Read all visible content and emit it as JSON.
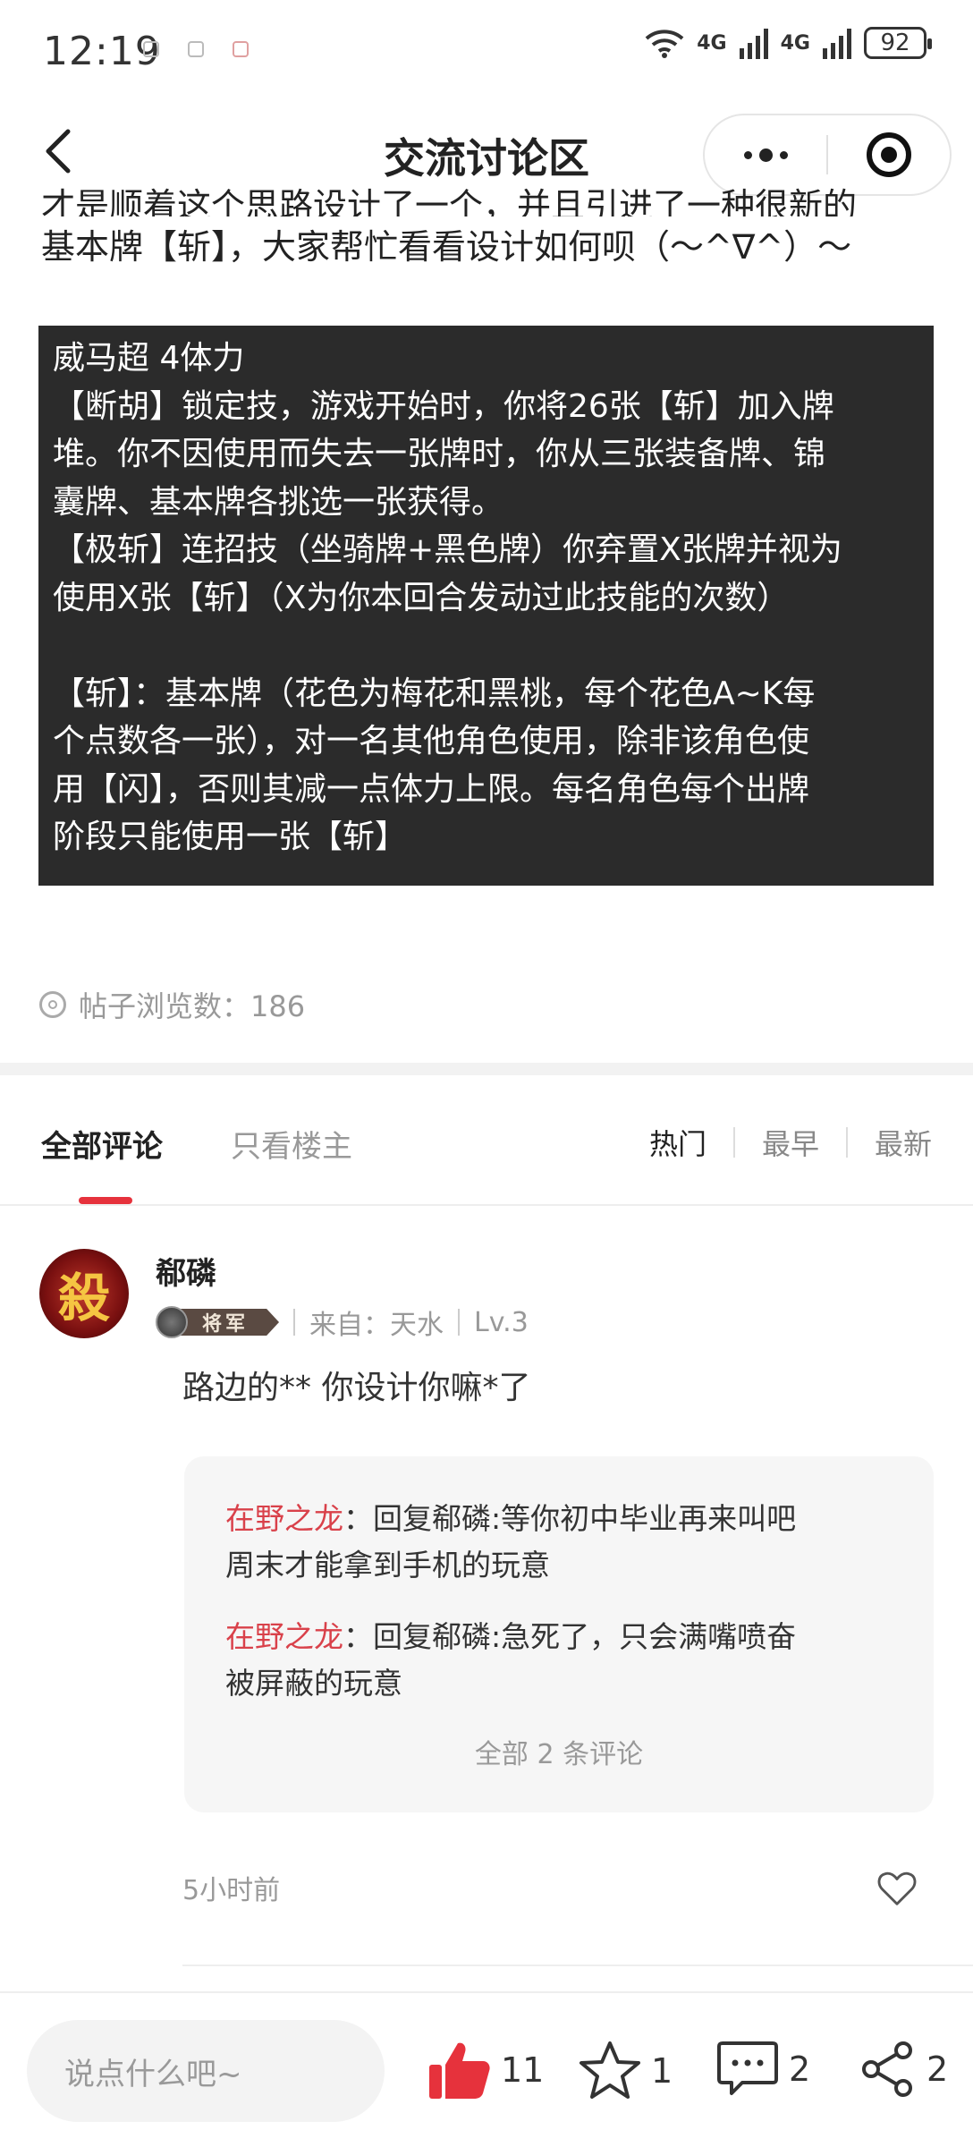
{
  "status_bar": {
    "time": "12:19",
    "network_1": "4G",
    "network_2": "4G",
    "battery": "92"
  },
  "header": {
    "title": "交流讨论区",
    "back_icon": "chevron-left-icon",
    "more_icon": "more-dots-icon",
    "close_icon": "target-circle-icon"
  },
  "post": {
    "intro_line_1": "才是顺着这个思路设计了一个，并且引进了一种很新的",
    "intro_line_2": "基本牌【斩】，大家帮忙看看设计如何呗（～^∇^）～",
    "box_lines": [
      "威马超  4体力",
      "【断胡】锁定技，游戏开始时，你将26张【斩】加入牌",
      "堆。你不因使用而失去一张牌时，你从三张装备牌、锦",
      "囊牌、基本牌各挑选一张获得。",
      "【极斩】连招技（坐骑牌+黑色牌）你弃置X张牌并视为",
      "使用X张【斩】（X为你本回合发动过此技能的次数）",
      "【斩】：基本牌（花色为梅花和黑桃，每个花色A~K每",
      "个点数各一张），对一名其他角色使用，除非该角色使",
      "用【闪】，否则其减一点体力上限。每名角色每个出牌",
      "阶段只能使用一张【斩】"
    ],
    "views_label": "帖子浏览数：",
    "views_count": "186"
  },
  "comment_tabs": {
    "all": "全部评论",
    "owner_only": "只看楼主",
    "sort_hot": "热门",
    "sort_earliest": "最早",
    "sort_newest": "最新",
    "accent_color": "#e6323c"
  },
  "comment": {
    "avatar_glyph": "殺",
    "username": "郗磷",
    "rank_badge": "将军",
    "source": "来自：天水",
    "level": "Lv.3",
    "text": "路边的** 你设计你嘛*了",
    "replies": [
      {
        "author": "在野之龙",
        "line_1": "：回复郗磷:等你初中毕业再来叫吧",
        "line_2": "周末才能拿到手机的玩意"
      },
      {
        "author": "在野之龙",
        "line_1": "：回复郗磷:急死了，只会满嘴喷奋",
        "line_2": "被屏蔽的玩意"
      }
    ],
    "all_replies": "全部 2 条评论",
    "time": "5小时前"
  },
  "bottom_bar": {
    "input_placeholder": "说点什么吧~",
    "like_count": "11",
    "star_count": "1",
    "comment_count": "2",
    "share_count": "2",
    "like_color": "#e6323c"
  }
}
